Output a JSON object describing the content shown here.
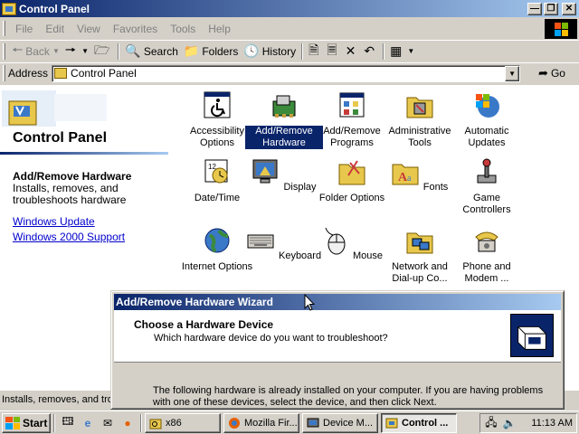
{
  "window": {
    "title": "Control Panel",
    "buttons": [
      "minimize",
      "restore",
      "close"
    ]
  },
  "menubar": {
    "items": [
      "File",
      "Edit",
      "View",
      "Favorites",
      "Tools",
      "Help"
    ]
  },
  "toolbar": {
    "back_label": "Back",
    "search_label": "Search",
    "folders_label": "Folders",
    "history_label": "History"
  },
  "address": {
    "label": "Address",
    "value": "Control Panel",
    "go_label": "Go"
  },
  "left_pane": {
    "title": "Control Panel",
    "selected_title": "Add/Remove Hardware",
    "selected_desc": "Installs, removes, and troubleshoots hardware",
    "links": [
      "Windows Update",
      "Windows 2000 Support"
    ]
  },
  "icons": [
    {
      "label": "Accessibility Options",
      "icon": "accessibility-icon"
    },
    {
      "label": "Add/Remove Hardware",
      "icon": "hardware-icon",
      "selected": true
    },
    {
      "label": "Add/Remove Programs",
      "icon": "programs-icon"
    },
    {
      "label": "Administrative Tools",
      "icon": "admin-tools-icon"
    },
    {
      "label": "Automatic Updates",
      "icon": "windows-update-icon"
    },
    {
      "label": "Date/Time",
      "icon": "calendar-icon"
    },
    {
      "label": "Display",
      "icon": "monitor-icon"
    },
    {
      "label": "Folder Options",
      "icon": "folder-options-icon"
    },
    {
      "label": "Fonts",
      "icon": "fonts-icon"
    },
    {
      "label": "Game Controllers",
      "icon": "joystick-icon"
    },
    {
      "label": "Internet Options",
      "icon": "globe-icon"
    },
    {
      "label": "Keyboard",
      "icon": "keyboard-icon"
    },
    {
      "label": "Mouse",
      "icon": "mouse-icon"
    },
    {
      "label": "Network and Dial-up Co...",
      "icon": "network-icon"
    },
    {
      "label": "Phone and Modem ...",
      "icon": "phone-icon"
    }
  ],
  "statusbar": {
    "text": "Installs, removes, and tro"
  },
  "wizard": {
    "title": "Add/Remove Hardware Wizard",
    "heading": "Choose a Hardware Device",
    "subheading": "Which hardware device do you want to troubleshoot?",
    "body": "The following hardware is already installed on your computer. If you are having problems with one of these devices, select the device, and then click Next."
  },
  "taskbar": {
    "start_label": "Start",
    "quicklaunch": [
      "show-desktop-icon",
      "ie-icon",
      "outlook-icon",
      "firefox-icon"
    ],
    "tasks": [
      {
        "label": "x86",
        "icon": "search-folder-icon",
        "active": false
      },
      {
        "label": "Mozilla Fir...",
        "icon": "firefox-icon",
        "active": false
      },
      {
        "label": "Device M...",
        "icon": "device-manager-icon",
        "active": false
      },
      {
        "label": "Control ...",
        "icon": "control-panel-icon",
        "active": true
      }
    ],
    "tray_icons": [
      "network-tray-icon",
      "volume-icon"
    ],
    "clock": "11:13 AM"
  },
  "colors": {
    "title_active": "#0a246a",
    "title_gradient_end": "#a6caf0",
    "face": "#d4d0c8",
    "selection": "#0a246a",
    "link": "#0000cc"
  }
}
